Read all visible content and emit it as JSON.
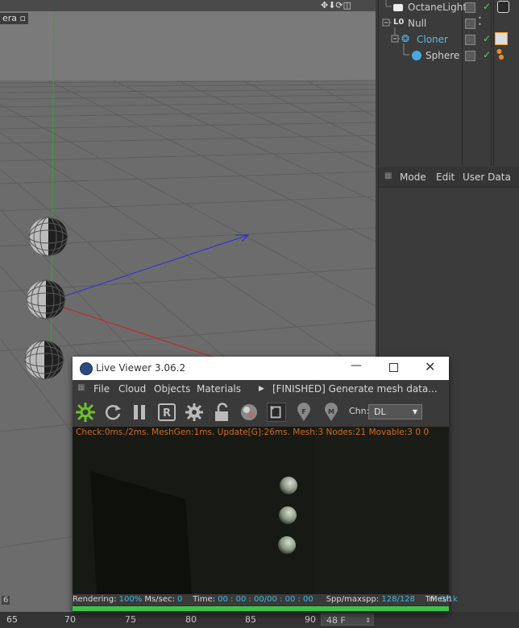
{
  "viewport": {
    "camera_label": "era"
  },
  "object_manager": {
    "objects": [
      {
        "name": "OctaneLight",
        "icon": "light-icon"
      },
      {
        "name": "Null",
        "icon": "null-icon"
      },
      {
        "name": "Cloner",
        "icon": "cloner-icon"
      },
      {
        "name": "Sphere",
        "icon": "sphere-icon"
      }
    ]
  },
  "attribute_manager": {
    "tabs": [
      "Mode",
      "Edit",
      "User Data"
    ]
  },
  "timeline": {
    "left_value": "6",
    "ticks": [
      "65",
      "70",
      "75",
      "80",
      "85",
      "90"
    ],
    "frame": "48 F"
  },
  "live_viewer": {
    "title": "Live Viewer 3.06.2",
    "menu": [
      "File",
      "Cloud",
      "Objects",
      "Materials"
    ],
    "status_message": "[FINISHED] Generate mesh data...",
    "channel_label": "Chn:",
    "channel_value": "DL",
    "stats": "Check:0ms./2ms. MeshGen:1ms. Update[G]:26ms. Mesh:3 Nodes:21 Movable:3  0 0",
    "status_bar": {
      "rendering_label": "Rendering:",
      "rendering_value": "100%",
      "mssec_label": "Ms/sec:",
      "mssec_value": "0",
      "time_label": "Time:",
      "time_value": "00 : 00 : 00/00 : 00 : 00",
      "spp_label": "Spp/maxspp:",
      "spp_value": "128/128",
      "tri_label": "Tri:",
      "tri_value": "0/1k",
      "mesh_label": "Mesh"
    },
    "progress": 1.0
  },
  "colors": {
    "accent_green": "#3dc24a",
    "stats_orange": "#d46a1a",
    "status_cyan": "#3fb6e0"
  }
}
